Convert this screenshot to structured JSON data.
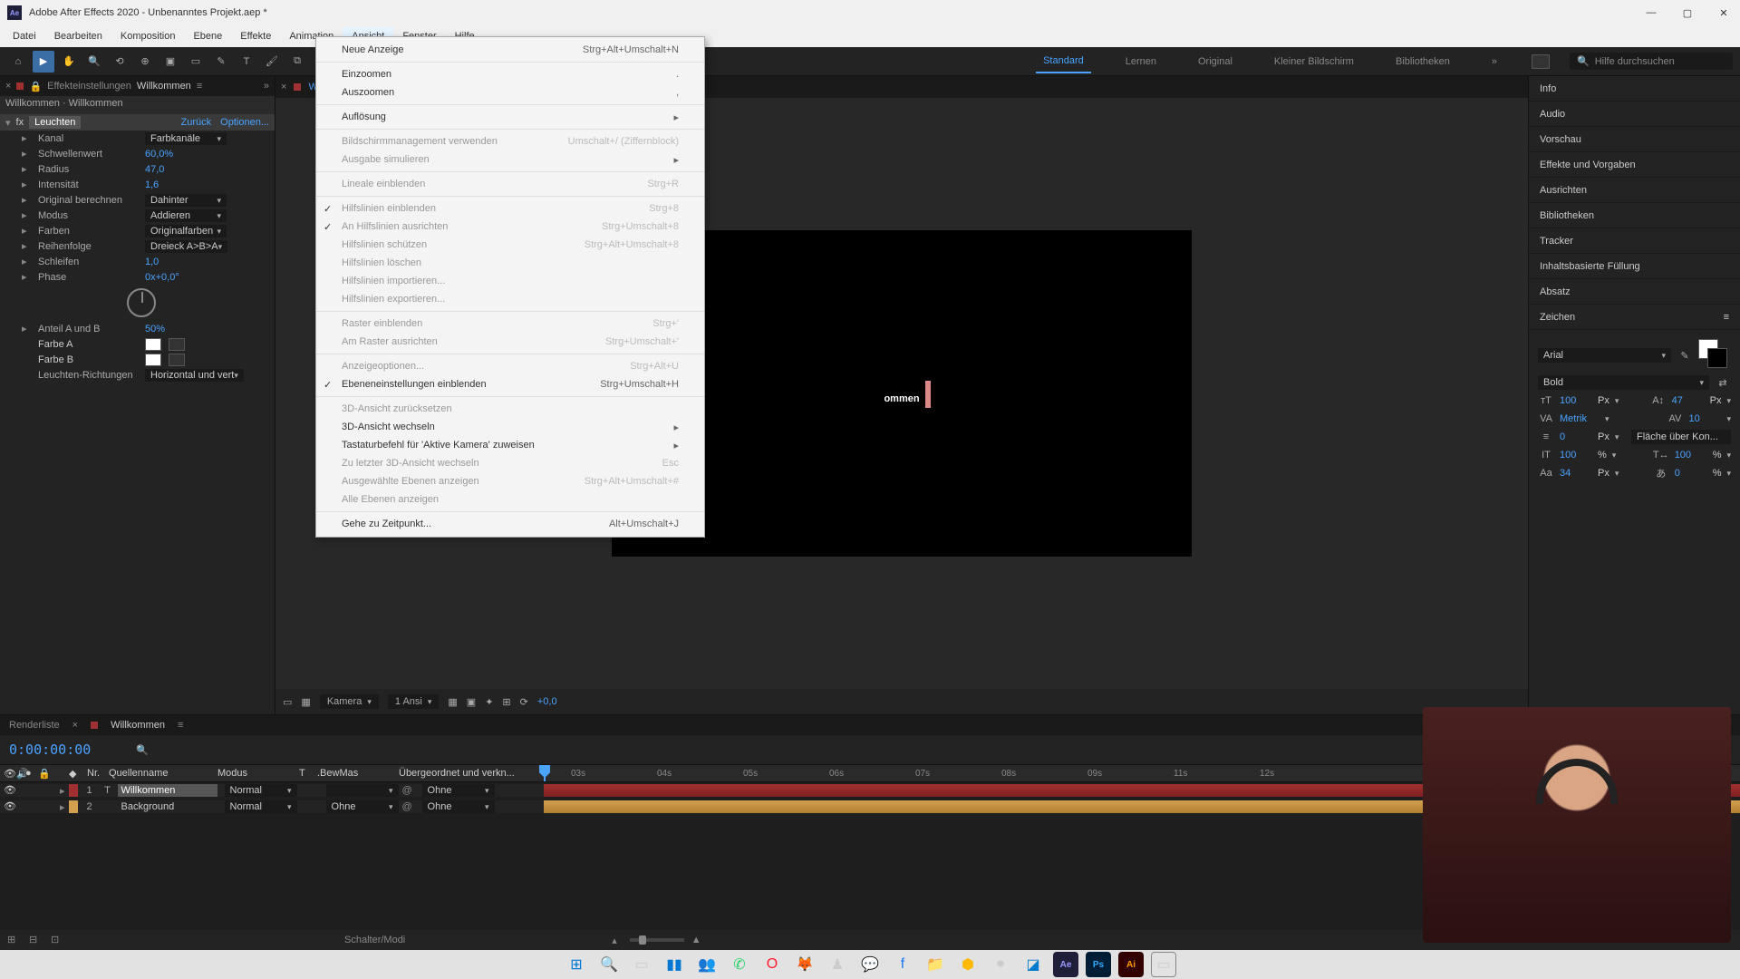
{
  "title": "Adobe After Effects 2020 - Unbenanntes Projekt.aep *",
  "menubar": [
    "Datei",
    "Bearbeiten",
    "Komposition",
    "Ebene",
    "Effekte",
    "Animation",
    "Ansicht",
    "Fenster",
    "Hilfe"
  ],
  "workspaces": {
    "active": "Standard",
    "items": [
      "Standard",
      "Lernen",
      "Original",
      "Kleiner Bildschirm",
      "Bibliotheken"
    ]
  },
  "search_help_placeholder": "Hilfe durchsuchen",
  "dropdown": {
    "groups": [
      [
        {
          "label": "Neue Anzeige",
          "shortcut": "Strg+Alt+Umschalt+N"
        }
      ],
      [
        {
          "label": "Einzoomen",
          "shortcut": "."
        },
        {
          "label": "Auszoomen",
          "shortcut": ","
        }
      ],
      [
        {
          "label": "Auflösung",
          "submenu": true
        }
      ],
      [
        {
          "label": "Bildschirmmanagement verwenden",
          "shortcut": "Umschalt+/ (Ziffernblock)",
          "disabled": true
        },
        {
          "label": "Ausgabe simulieren",
          "submenu": true,
          "disabled": true
        }
      ],
      [
        {
          "label": "Lineale einblenden",
          "shortcut": "Strg+R",
          "disabled": true
        }
      ],
      [
        {
          "label": "Hilfslinien einblenden",
          "shortcut": "Strg+8",
          "disabled": true,
          "checked": true
        },
        {
          "label": "An Hilfslinien ausrichten",
          "shortcut": "Strg+Umschalt+8",
          "disabled": true,
          "checked": true
        },
        {
          "label": "Hilfslinien schützen",
          "shortcut": "Strg+Alt+Umschalt+8",
          "disabled": true
        },
        {
          "label": "Hilfslinien löschen",
          "disabled": true
        },
        {
          "label": "Hilfslinien importieren...",
          "disabled": true
        },
        {
          "label": "Hilfslinien exportieren...",
          "disabled": true
        }
      ],
      [
        {
          "label": "Raster einblenden",
          "shortcut": "Strg+'",
          "disabled": true
        },
        {
          "label": "Am Raster ausrichten",
          "shortcut": "Strg+Umschalt+'",
          "disabled": true
        }
      ],
      [
        {
          "label": "Anzeigeoptionen...",
          "shortcut": "Strg+Alt+U",
          "disabled": true
        },
        {
          "label": "Ebeneneinstellungen einblenden",
          "shortcut": "Strg+Umschalt+H",
          "checked": true
        }
      ],
      [
        {
          "label": "3D-Ansicht zurücksetzen",
          "disabled": true
        },
        {
          "label": "3D-Ansicht wechseln",
          "submenu": true
        },
        {
          "label": "Tastaturbefehl für 'Aktive Kamera' zuweisen",
          "submenu": true
        },
        {
          "label": "Zu letzter 3D-Ansicht wechseln",
          "shortcut": "Esc",
          "disabled": true
        },
        {
          "label": "Ausgewählte Ebenen anzeigen",
          "shortcut": "Strg+Alt+Umschalt+#",
          "disabled": true
        },
        {
          "label": "Alle Ebenen anzeigen",
          "disabled": true
        }
      ],
      [
        {
          "label": "Gehe zu Zeitpunkt...",
          "shortcut": "Alt+Umschalt+J"
        }
      ]
    ]
  },
  "fx_panel": {
    "tab1": "Effekteinstellungen",
    "tab2": "Willkommen",
    "comp": "Willkommen · Willkommen",
    "effect": "Leuchten",
    "reset": "Zurück",
    "options": "Optionen...",
    "rows": [
      {
        "label": "Kanal",
        "dd": "Farbkanäle"
      },
      {
        "label": "Schwellenwert",
        "val": "60,0%"
      },
      {
        "label": "Radius",
        "val": "47,0"
      },
      {
        "label": "Intensität",
        "val": "1,6"
      },
      {
        "label": "Original berechnen",
        "dd": "Dahinter"
      },
      {
        "label": "Modus",
        "dd": "Addieren"
      },
      {
        "label": "Farben",
        "dd": "Originalfarben"
      },
      {
        "label": "Reihenfolge",
        "dd": "Dreieck A>B>A"
      },
      {
        "label": "Schleifen",
        "val": "1,0"
      },
      {
        "label": "Phase",
        "val": "0x+0,0°"
      }
    ],
    "anteil": {
      "label": "Anteil A und B",
      "val": "50%"
    },
    "farbeA": "Farbe A",
    "farbeB": "Farbe B",
    "richtungen": {
      "label": "Leuchten-Richtungen",
      "dd": "Horizontal und vert"
    }
  },
  "comp_viewer": {
    "tab": "W",
    "text": "ommen",
    "camera": "Kamera",
    "views": "1 Ansi",
    "exposure": "+0,0"
  },
  "right_panels": [
    "Info",
    "Audio",
    "Vorschau",
    "Effekte und Vorgaben",
    "Ausrichten",
    "Bibliotheken",
    "Tracker",
    "Inhaltsbasierte Füllung",
    "Absatz"
  ],
  "char_panel": {
    "title": "Zeichen",
    "font": "Arial",
    "style": "Bold",
    "size": "100",
    "size_unit": "Px",
    "leading": "47",
    "leading_unit": "Px",
    "kerning": "Metrik",
    "tracking": "10",
    "stroke": "0",
    "stroke_unit": "Px",
    "stroke_over": "Fläche über Kon...",
    "vscale": "100",
    "vscale_unit": "%",
    "hscale": "100",
    "hscale_unit": "%",
    "baseline": "34",
    "baseline_unit": "Px",
    "tsume": "0",
    "tsume_unit": "%"
  },
  "timeline": {
    "tabs": [
      "Renderliste",
      "Willkommen"
    ],
    "timecode": "0:00:00:00",
    "cols": {
      "nr": "Nr.",
      "name": "Quellenname",
      "mode": "Modus",
      "t": "T",
      "bew": ".BewMas",
      "parent": "Übergeordnet und verkn..."
    },
    "rows": [
      {
        "num": "1",
        "type": "T",
        "name": "Willkommen",
        "mode": "Normal",
        "bew": "",
        "parent": "Ohne",
        "color": "#a03030",
        "selected": true
      },
      {
        "num": "2",
        "type": "",
        "name": "Background",
        "mode": "Normal",
        "bew": "Ohne",
        "parent": "Ohne",
        "color": "#d4a050"
      }
    ],
    "ruler": [
      "03s",
      "04s",
      "05s",
      "06s",
      "07s",
      "08s",
      "09s",
      "11s",
      "12s"
    ],
    "schalter": "Schalter/Modi"
  }
}
